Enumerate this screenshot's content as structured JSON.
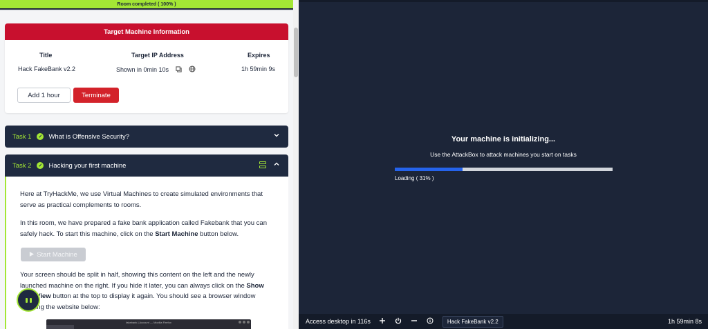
{
  "room_progress": {
    "label": "Room completed ( 100% )",
    "value": 100
  },
  "target_machine": {
    "header": "Target Machine Information",
    "columns": {
      "title_header": "Title",
      "ip_header": "Target IP Address",
      "expires_header": "Expires"
    },
    "values": {
      "title": "Hack FakeBank v2.2",
      "ip": "Shown in 0min 10s",
      "expires": "1h 59min 9s"
    },
    "add_hour_label": "Add 1 hour",
    "terminate_label": "Terminate"
  },
  "tasks": [
    {
      "num": "Task 1",
      "title": "What is Offensive Security?",
      "expanded": false
    },
    {
      "num": "Task 2",
      "title": "Hacking your first machine",
      "expanded": true
    }
  ],
  "task2_content": {
    "p1": "Here at TryHackMe, we use Virtual Machines to create simulated environments that serve as practical complements to rooms.",
    "p2_part1": "In this room, we have prepared a fake bank application called Fakebank that you can safely hack. To start this machine, click on the ",
    "p2_bold": "Start Machine",
    "p2_part2": " button below.",
    "start_button_label": "Start Machine",
    "p3_part1": "Your screen should be split in half, showing this content on the left and the newly launched machine on the right. If you hide it later, you can always click on the ",
    "p3_bold": "Show Split View",
    "p3_part2": " button at the top to display it again. You should see a browser window showing the website below:",
    "preview_window_title": "fakebank | Account — Mozilla Firefox"
  },
  "attackbox": {
    "title": "Your machine is initializing...",
    "subtitle": "Use the AttackBox to attack machines you start on tasks",
    "loading_label": "Loading ( 31% )",
    "loading_value": 31,
    "colors": {
      "fill": "#2563eb",
      "track": "#d1d5db",
      "bg": "#1c2538"
    }
  },
  "bottom_bar": {
    "access_text": "Access desktop in 116s",
    "icons": [
      "plus-icon",
      "power-icon",
      "minus-icon",
      "info-icon"
    ],
    "vm_tab_label": "Hack FakeBank v2.2",
    "timer": "1h 59min 8s"
  },
  "colors": {
    "accent_green": "#a3e635",
    "danger_red": "#c8102e",
    "navy": "#1f2a40"
  }
}
